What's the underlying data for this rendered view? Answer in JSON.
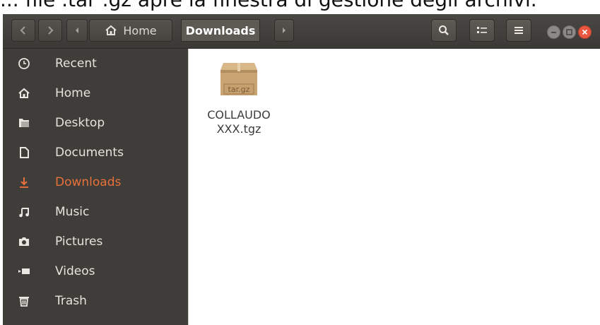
{
  "caption": "... file .tar .gz apre la finestra di gestione degli archivi.",
  "toolbar": {
    "home_label": "Home",
    "current_label": "Downloads"
  },
  "sidebar": {
    "items": [
      {
        "label": "Recent",
        "icon": "clock-icon"
      },
      {
        "label": "Home",
        "icon": "home-icon"
      },
      {
        "label": "Desktop",
        "icon": "folder-icon"
      },
      {
        "label": "Documents",
        "icon": "document-icon"
      },
      {
        "label": "Downloads",
        "icon": "download-icon",
        "active": true
      },
      {
        "label": "Music",
        "icon": "music-icon"
      },
      {
        "label": "Pictures",
        "icon": "camera-icon"
      },
      {
        "label": "Videos",
        "icon": "video-icon"
      },
      {
        "label": "Trash",
        "icon": "trash-icon"
      }
    ]
  },
  "files": [
    {
      "name": "COLLAUDO\nXXX.tgz",
      "badge": "tar.gz",
      "icon": "archive-icon"
    }
  ],
  "colors": {
    "accent": "#e9703a",
    "sidebar_bg": "#3f3d39",
    "titlebar_bg": "#3b3935",
    "close": "#e9573f",
    "minmax": "#8c8a86"
  }
}
